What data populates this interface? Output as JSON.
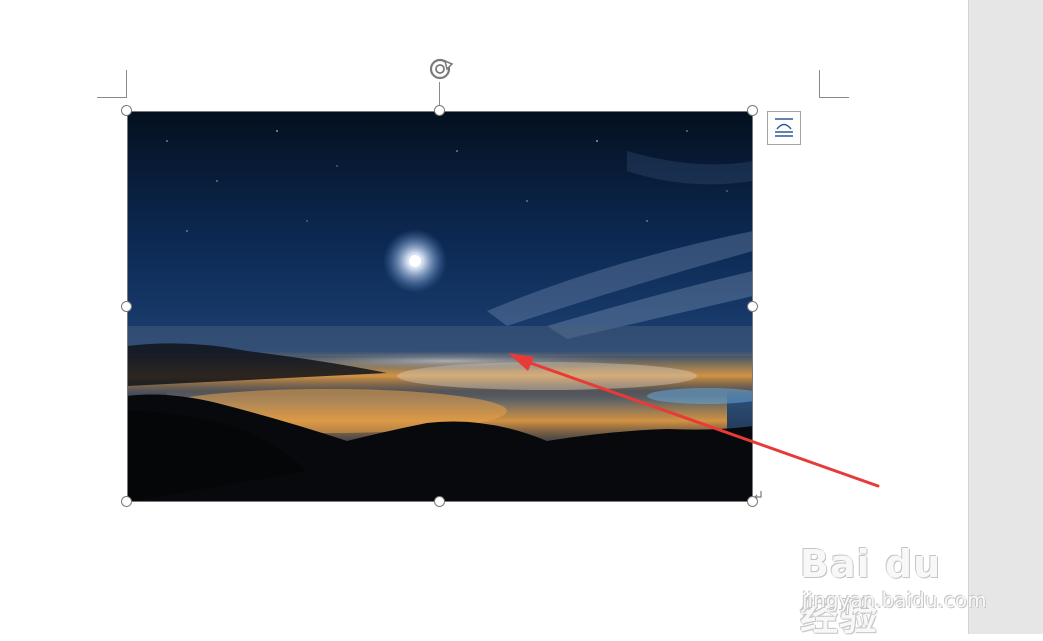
{
  "document": {
    "image_description_icon": "night-landscape-photo",
    "rotate_handle_icon": "rotate-icon",
    "layout_options_icon": "layout-options-icon"
  },
  "annotation": {
    "arrow_color": "#e83a36"
  },
  "watermark": {
    "brand": "Bai du 经验",
    "url": "jingyan.baidu.com"
  }
}
